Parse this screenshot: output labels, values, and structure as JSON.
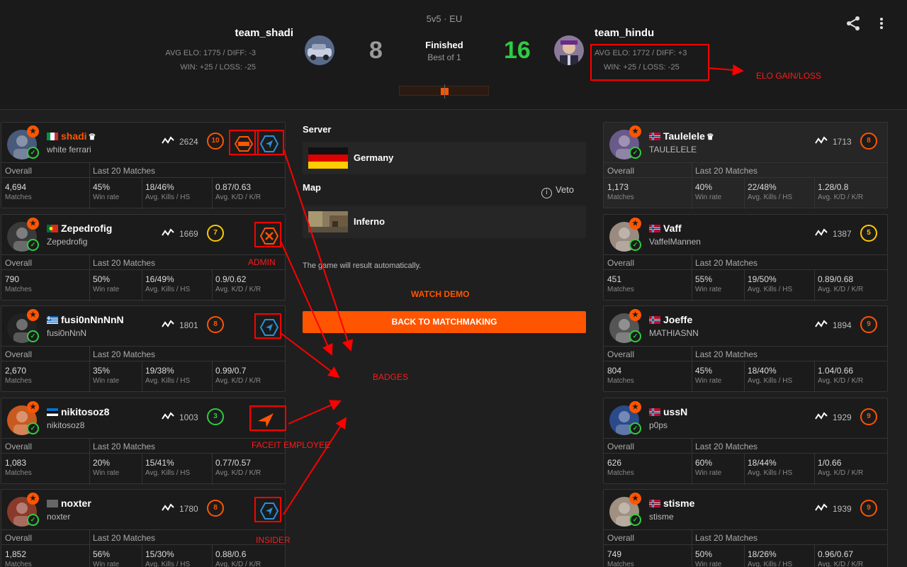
{
  "match": {
    "mode": "5v5 · EU",
    "status": "Finished",
    "format": "Best of 1",
    "team1": {
      "name": "team_shadi",
      "elo_line": "AVG ELO: 1775 / DIFF: -3",
      "win_line": "WIN: +25 / LOSS: -25",
      "score": "8"
    },
    "team2": {
      "name": "team_hindu",
      "elo_line": "AVG ELO: 1772 / DIFF: +3",
      "win_line": "WIN: +25 / LOSS: -25",
      "score": "16"
    },
    "share_icon": "share-icon",
    "more_icon": "more-vertical-icon"
  },
  "stat_headers": {
    "overall": "Overall",
    "last20": "Last 20 Matches"
  },
  "stat_labels": {
    "matches": "Matches",
    "winrate": "Win rate",
    "kills_hs": "Avg. Kills / HS",
    "kd": "Avg. K/D / K/R"
  },
  "left_players": [
    {
      "nick": "shadi",
      "real": "white ferrari",
      "elo": "2624",
      "level": "10",
      "matches": "4,694",
      "winrate": "45%",
      "kills_hs": "18/46%",
      "kd": "0.87/0.63",
      "flag": "italy",
      "badges": [
        "admin-hex-badge",
        "insider-badge"
      ]
    },
    {
      "nick": "Zepedrofig",
      "real": "Zepedrofig",
      "elo": "1669",
      "level": "7",
      "matches": "790",
      "winrate": "50%",
      "kills_hs": "16/49%",
      "kd": "0.9/0.62",
      "flag": "portugal",
      "badges": [
        "admin-tools-badge"
      ]
    },
    {
      "nick": "fusi0nNnNnN",
      "real": "fusi0nNnN",
      "elo": "1801",
      "level": "8",
      "matches": "2,670",
      "winrate": "35%",
      "kills_hs": "19/38%",
      "kd": "0.99/0.7",
      "flag": "greece",
      "badges": [
        "insider-badge"
      ]
    },
    {
      "nick": "nikitosoz8",
      "real": "nikitosoz8",
      "elo": "1003",
      "level": "3",
      "matches": "1,083",
      "winrate": "20%",
      "kills_hs": "15/41%",
      "kd": "0.77/0.57",
      "flag": "estonia",
      "badges": [
        "faceit-employee-badge"
      ]
    },
    {
      "nick": "noxter",
      "real": "noxter",
      "elo": "1780",
      "level": "8",
      "matches": "1,852",
      "winrate": "56%",
      "kills_hs": "15/30%",
      "kd": "0.88/0.6",
      "flag": "unknown",
      "badges": [
        "insider-badge"
      ]
    }
  ],
  "right_players": [
    {
      "nick": "Taulelele",
      "real": "TAULELELE",
      "elo": "1713",
      "level": "8",
      "matches": "1,173",
      "winrate": "40%",
      "kills_hs": "22/48%",
      "kd": "1.28/0.8",
      "flag": "norway"
    },
    {
      "nick": "Vaff",
      "real": "VaffelMannen",
      "elo": "1387",
      "level": "5",
      "matches": "451",
      "winrate": "55%",
      "kills_hs": "19/50%",
      "kd": "0.89/0.68",
      "flag": "norway"
    },
    {
      "nick": "Joeffe",
      "real": "MATHIASNN",
      "elo": "1894",
      "level": "9",
      "matches": "804",
      "winrate": "45%",
      "kills_hs": "18/40%",
      "kd": "1.04/0.66",
      "flag": "norway"
    },
    {
      "nick": "ussN",
      "real": "p0ps",
      "elo": "1929",
      "level": "9",
      "matches": "626",
      "winrate": "60%",
      "kills_hs": "18/44%",
      "kd": "1/0.66",
      "flag": "norway"
    },
    {
      "nick": "stisme",
      "real": "stisme",
      "elo": "1939",
      "level": "9",
      "matches": "749",
      "winrate": "50%",
      "kills_hs": "18/26%",
      "kd": "0.96/0.67",
      "flag": "norway"
    }
  ],
  "center": {
    "server_title": "Server",
    "server_name": "Germany",
    "map_title": "Map",
    "veto_label": "Veto",
    "map_name": "Inferno",
    "auto_text": "The game will result automatically.",
    "watch_demo": "WATCH DEMO",
    "back_button": "BACK TO MATCHMAKING"
  },
  "annotations": {
    "elo_gain": "ELO GAIN/LOSS",
    "admin": "ADMIN",
    "badges": "BADGES",
    "faceit_employee": "FACEIT EMPLOYEE",
    "insider": "INSIDER"
  },
  "colors": {
    "accent": "#ff5500",
    "win": "#2ecc40",
    "annotation": "#ff0000",
    "level_low": "#2ecc40",
    "level_mid": "#ffc800"
  }
}
